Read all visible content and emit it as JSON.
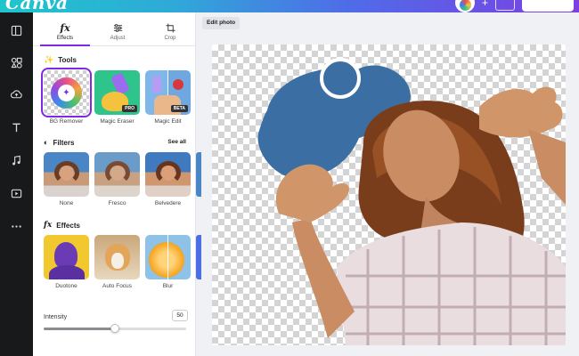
{
  "app": {
    "logo": "Canva"
  },
  "rail": {
    "items": [
      "layout-icon",
      "elements-icon",
      "uploads-icon",
      "text-icon",
      "audio-icon",
      "video-icon",
      "more-icon"
    ]
  },
  "panel": {
    "tabs": [
      {
        "label": "Effects",
        "icon": "fx-icon",
        "active": true
      },
      {
        "label": "Adjust",
        "icon": "sliders-icon",
        "active": false
      },
      {
        "label": "Crop",
        "icon": "crop-icon",
        "active": false
      }
    ],
    "tools": {
      "title": "Tools",
      "items": [
        {
          "label": "BG Remover",
          "selected": true,
          "badge": ""
        },
        {
          "label": "Magic Eraser",
          "selected": false,
          "badge": "PRO"
        },
        {
          "label": "Magic Edit",
          "selected": false,
          "badge": "BETA"
        }
      ]
    },
    "filters": {
      "title": "Filters",
      "see_all": "See all",
      "items": [
        {
          "label": "None"
        },
        {
          "label": "Fresco"
        },
        {
          "label": "Belvedere"
        }
      ]
    },
    "effects": {
      "title": "Effects",
      "items": [
        {
          "label": "Duotone"
        },
        {
          "label": "Auto Focus"
        },
        {
          "label": "Blur"
        }
      ]
    },
    "intensity": {
      "label": "Intensity",
      "value": "50",
      "fraction": 0.5
    }
  },
  "main": {
    "edit_photo_label": "Edit photo"
  },
  "colors": {
    "accent": "#7d2ae8",
    "shape_blue": "#3b6fa3"
  }
}
